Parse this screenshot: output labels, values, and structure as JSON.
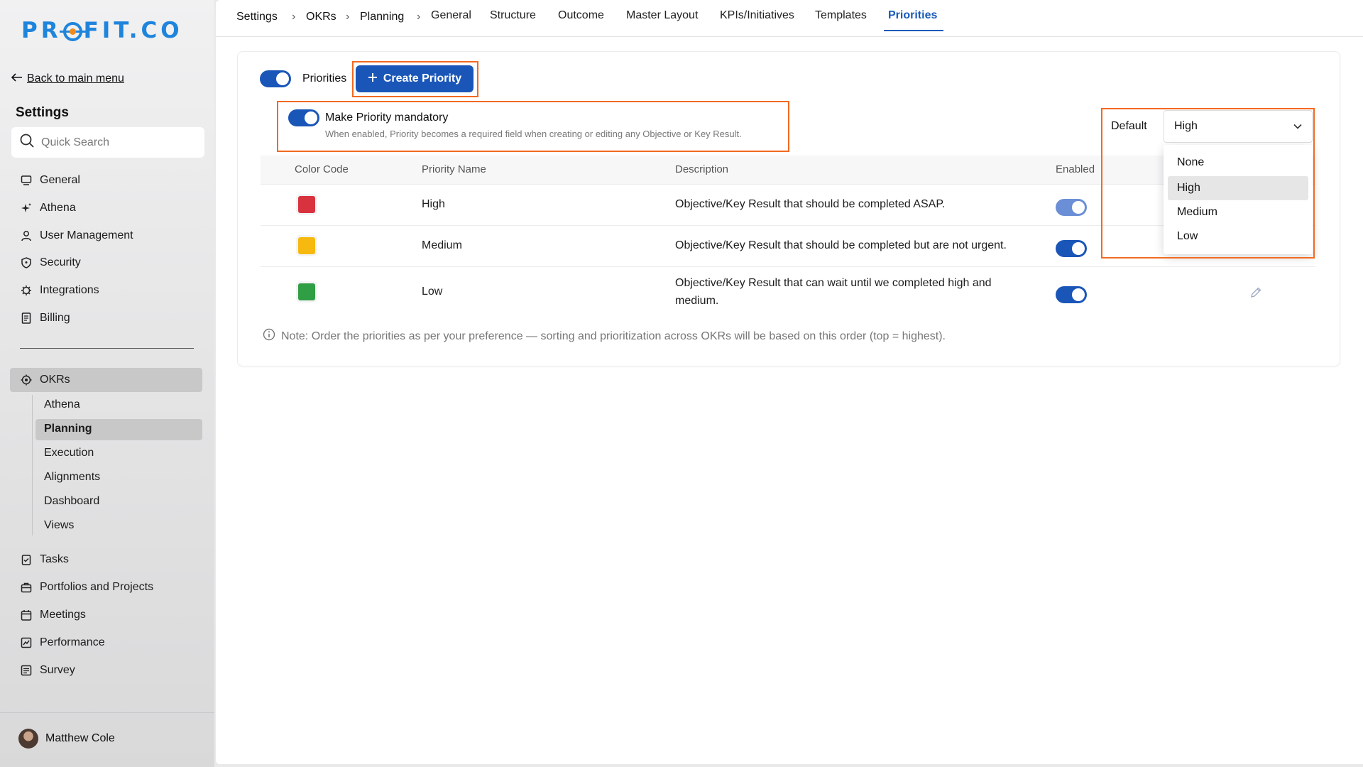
{
  "brand": {
    "logo_text_1": "PR",
    "logo_text_2": "FIT.CO"
  },
  "sidebar": {
    "back_label": "Back to main menu",
    "title": "Settings",
    "search_placeholder": "Quick Search",
    "top_items": [
      {
        "label": "General",
        "icon": "monitor-icon"
      },
      {
        "label": "Athena",
        "icon": "sparkle-icon"
      },
      {
        "label": "User Management",
        "icon": "user-icon"
      },
      {
        "label": "Security",
        "icon": "shield-icon"
      },
      {
        "label": "Integrations",
        "icon": "gear-icon"
      },
      {
        "label": "Billing",
        "icon": "receipt-icon"
      }
    ],
    "okrs_label": "OKRs",
    "okr_sub": [
      "Athena",
      "Planning",
      "Execution",
      "Alignments",
      "Dashboard",
      "Views"
    ],
    "bottom_items": [
      {
        "label": "Tasks",
        "icon": "clipboard-icon"
      },
      {
        "label": "Portfolios and Projects",
        "icon": "briefcase-icon"
      },
      {
        "label": "Meetings",
        "icon": "calendar-icon"
      },
      {
        "label": "Performance",
        "icon": "chart-icon"
      },
      {
        "label": "Survey",
        "icon": "survey-icon"
      }
    ],
    "user_name": "Matthew Cole"
  },
  "breadcrumb": [
    "Settings",
    "OKRs",
    "Planning"
  ],
  "tabs": [
    "General",
    "Structure",
    "Outcome",
    "Master Layout",
    "KPIs/Initiatives",
    "Templates",
    "Priorities"
  ],
  "active_tab": "Priorities",
  "priorities": {
    "toggle_label": "Priorities",
    "create_button": "Create Priority",
    "mandatory_label": "Make Priority mandatory",
    "mandatory_hint": "When enabled, Priority becomes a required field when creating or editing any Objective or Key Result.",
    "default_label": "Default",
    "default_value": "High",
    "default_options": [
      "None",
      "High",
      "Medium",
      "Low"
    ],
    "columns": [
      "Color Code",
      "Priority Name",
      "Description",
      "Enabled"
    ],
    "rows": [
      {
        "name": "High",
        "color": "#d9323f",
        "description": "Objective/Key Result that should be completed ASAP.",
        "enabled": true
      },
      {
        "name": "Medium",
        "color": "#f7b90f",
        "description": "Objective/Key Result that should be completed but are not urgent.",
        "enabled": true
      },
      {
        "name": "Low",
        "color": "#2f9e44",
        "description_line1": "Objective/Key Result that can wait until we completed high and",
        "description_line2": "medium.",
        "enabled": true
      }
    ],
    "note": "Note: Order the priorities as per your preference — sorting and prioritization across OKRs will be based on this order (top = highest)."
  }
}
